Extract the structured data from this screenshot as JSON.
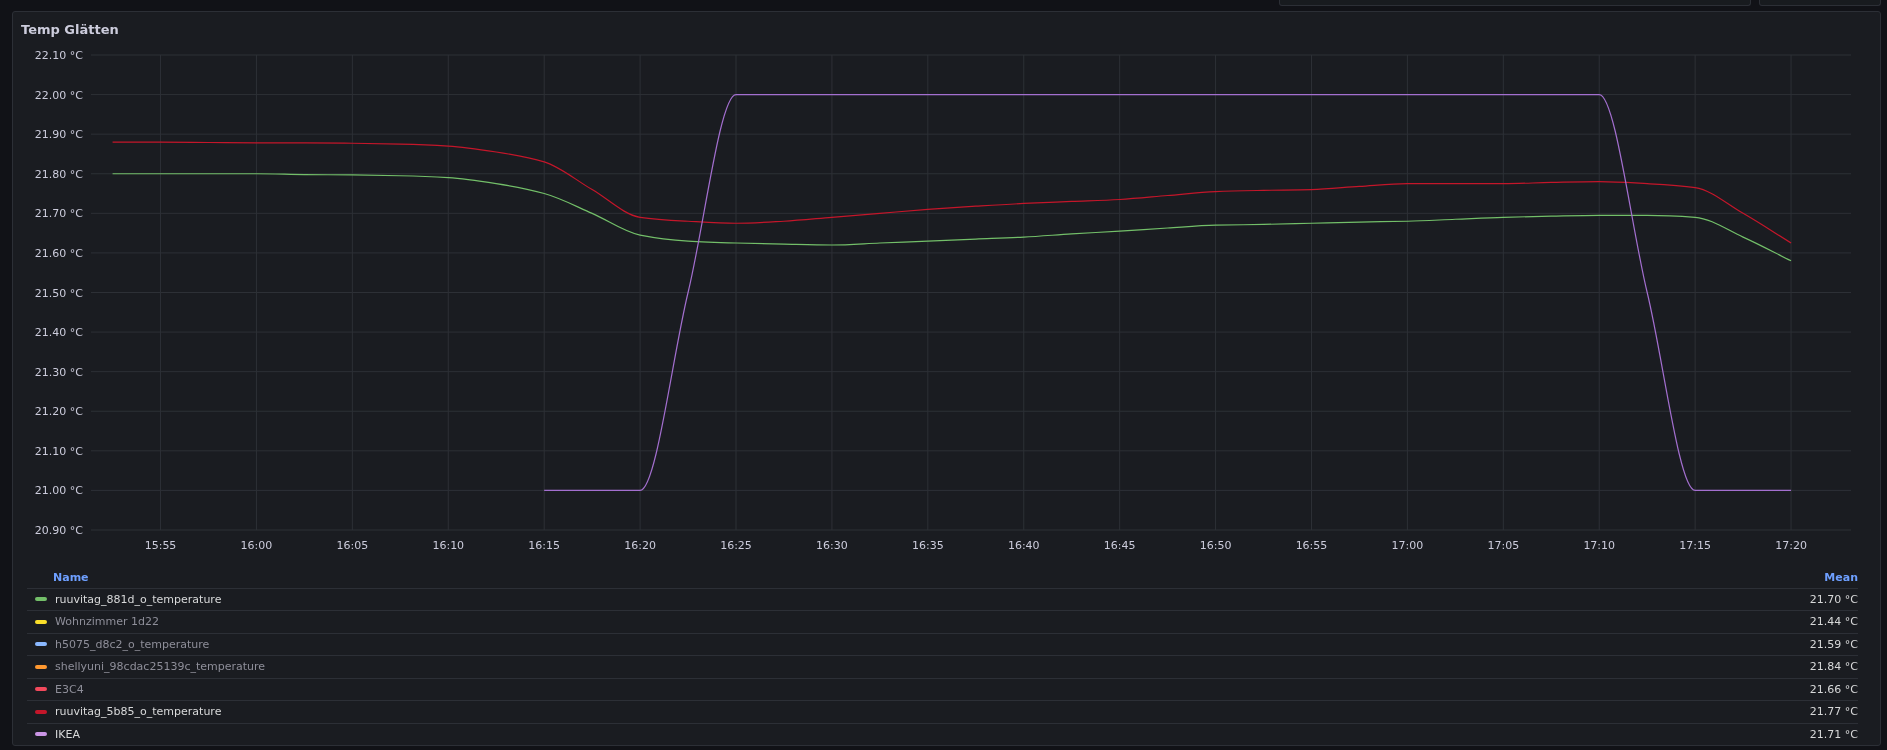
{
  "panel": {
    "title": "Temp Glätten",
    "chart_data": {
      "type": "line",
      "grid": true,
      "categories": [
        null,
        "15:55",
        null,
        "16:00",
        null,
        "16:05",
        null,
        "16:10",
        null,
        "16:15",
        null,
        "16:20",
        null,
        "16:25",
        null,
        "16:30",
        null,
        "16:35",
        null,
        "16:40",
        null,
        "16:45",
        null,
        "16:50",
        null,
        "16:55",
        null,
        "17:00",
        null,
        "17:05",
        null,
        "17:10",
        null,
        "17:15",
        null,
        "17:20"
      ],
      "ylim": [
        20.9,
        22.1
      ],
      "yticks": [
        {
          "value": 20.9,
          "label": "20.90 °C"
        },
        {
          "value": 21.0,
          "label": "21.00 °C"
        },
        {
          "value": 21.1,
          "label": "21.10 °C"
        },
        {
          "value": 21.2,
          "label": "21.20 °C"
        },
        {
          "value": 21.3,
          "label": "21.30 °C"
        },
        {
          "value": 21.4,
          "label": "21.40 °C"
        },
        {
          "value": 21.5,
          "label": "21.50 °C"
        },
        {
          "value": 21.6,
          "label": "21.60 °C"
        },
        {
          "value": 21.7,
          "label": "21.70 °C"
        },
        {
          "value": 21.8,
          "label": "21.80 °C"
        },
        {
          "value": 21.9,
          "label": "21.90 °C"
        },
        {
          "value": 22.0,
          "label": "22.00 °C"
        },
        {
          "value": 22.1,
          "label": "22.10 °C"
        }
      ],
      "series": [
        {
          "color": "#73bf69",
          "values": [
            21.8,
            21.8,
            21.8,
            21.8,
            21.798,
            21.797,
            21.795,
            21.79,
            21.775,
            21.75,
            21.7,
            21.645,
            21.63,
            21.625,
            21.622,
            21.62,
            21.625,
            21.63,
            21.635,
            21.64,
            21.648,
            21.655,
            21.663,
            21.67,
            21.672,
            21.675,
            21.678,
            21.68,
            21.685,
            21.69,
            21.693,
            21.695,
            21.695,
            21.69,
            21.64,
            21.58
          ]
        },
        {
          "color": "#c4162a",
          "values": [
            21.88,
            21.88,
            21.879,
            21.878,
            21.878,
            21.877,
            21.875,
            21.87,
            21.855,
            21.83,
            21.76,
            21.69,
            21.68,
            21.675,
            21.68,
            21.69,
            21.7,
            21.71,
            21.718,
            21.725,
            21.73,
            21.735,
            21.745,
            21.755,
            21.758,
            21.76,
            21.768,
            21.775,
            21.775,
            21.775,
            21.778,
            21.78,
            21.775,
            21.765,
            21.7,
            21.625
          ]
        },
        {
          "color": "#a36fcf",
          "values": [
            null,
            null,
            null,
            null,
            null,
            null,
            null,
            null,
            null,
            21.0,
            21.0,
            21.0,
            21.5,
            22.0,
            22.0,
            22.0,
            22.0,
            22.0,
            22.0,
            22.0,
            22.0,
            22.0,
            22.0,
            22.0,
            22.0,
            22.0,
            22.0,
            22.0,
            22.0,
            22.0,
            22.0,
            22.0,
            21.5,
            21.0,
            21.0,
            21.0
          ]
        }
      ]
    },
    "legend": {
      "columns": [
        "Name",
        "Mean"
      ],
      "items": [
        {
          "name": "ruuvitag_881d_o_temperature",
          "color": "#73bf69",
          "mean": "21.70 °C",
          "hidden": false
        },
        {
          "name": "Wohnzimmer 1d22",
          "color": "#fade2a",
          "mean": "21.44 °C",
          "hidden": true
        },
        {
          "name": "h5075_d8c2_o_temperature",
          "color": "#8ab8ff",
          "mean": "21.59 °C",
          "hidden": true
        },
        {
          "name": "shellyuni_98cdac25139c_temperature",
          "color": "#ff9830",
          "mean": "21.84 °C",
          "hidden": true
        },
        {
          "name": "E3C4",
          "color": "#f2495c",
          "mean": "21.66 °C",
          "hidden": true
        },
        {
          "name": "ruuvitag_5b85_o_temperature",
          "color": "#c4162a",
          "mean": "21.77 °C",
          "hidden": false
        },
        {
          "name": "IKEA",
          "color": "#ca95e5",
          "mean": "21.71 °C",
          "hidden": false
        }
      ]
    }
  }
}
